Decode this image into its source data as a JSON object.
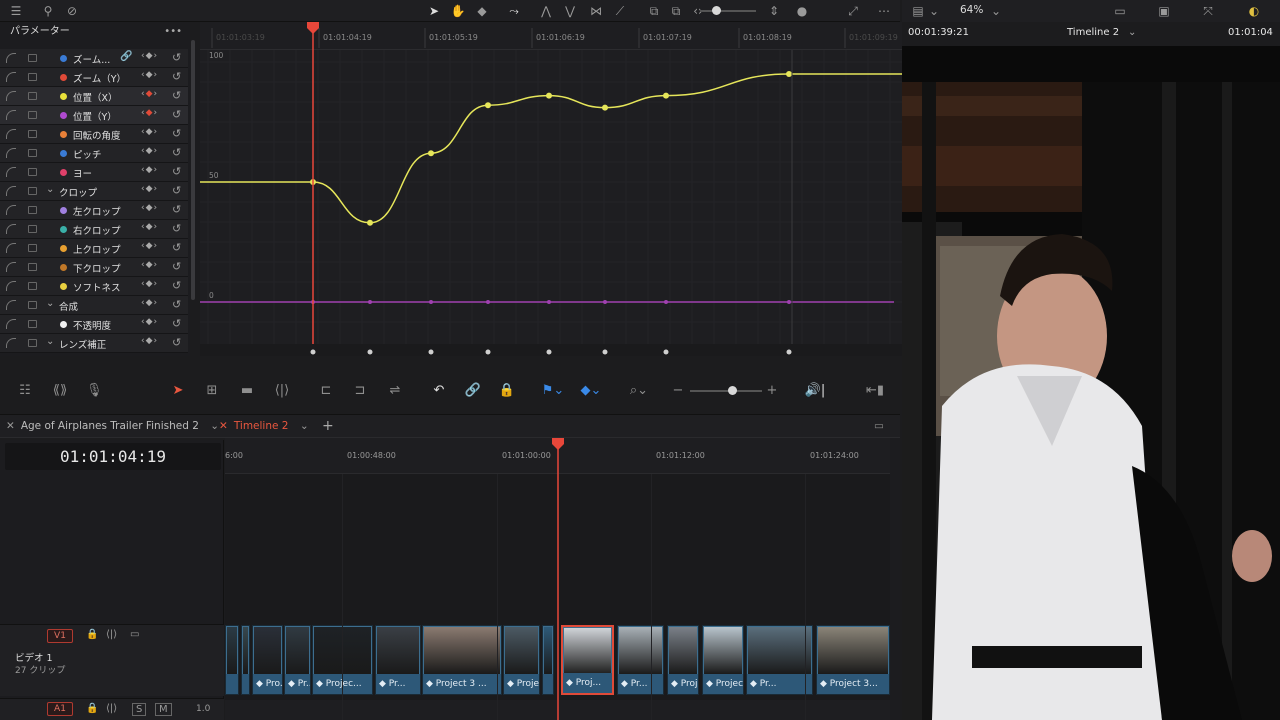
{
  "curve_editor": {
    "param_header": "パラメーター",
    "params": [
      {
        "label": "ズーム...",
        "color": "#3a7bd5",
        "linked": true
      },
      {
        "label": "ズーム（Y）",
        "color": "#e04a38"
      },
      {
        "label": "位置（X）",
        "color": "#e8e03a",
        "selected": true,
        "keyframe_active": true
      },
      {
        "label": "位置（Y）",
        "color": "#b04ad0",
        "selected": true,
        "keyframe_active": true
      },
      {
        "label": "回転の角度",
        "color": "#e88038"
      },
      {
        "label": "ピッチ",
        "color": "#3a7bd5"
      },
      {
        "label": "ヨー",
        "color": "#e0406a"
      },
      {
        "label": "クロップ",
        "group": true
      },
      {
        "label": "左クロップ",
        "color": "#a080e0"
      },
      {
        "label": "右クロップ",
        "color": "#3ab0a8"
      },
      {
        "label": "上クロップ",
        "color": "#e8a030"
      },
      {
        "label": "下クロップ",
        "color": "#c07828"
      },
      {
        "label": "ソフトネス",
        "color": "#e8d040"
      },
      {
        "label": "合成",
        "group": true
      },
      {
        "label": "不透明度",
        "color": "#f0f0f0"
      },
      {
        "label": "レンズ補正",
        "group": true
      }
    ],
    "ruler_labels": [
      "01:01:03:19",
      "01:01:04:19",
      "01:01:05:19",
      "01:01:06:19",
      "01:01:07:19",
      "01:01:08:19",
      "01:01:09:19"
    ],
    "y_labels": [
      "100",
      "50",
      "0"
    ],
    "curve_x": {
      "color": "#e6e65a",
      "keyframes": [
        50,
        33,
        62,
        82,
        86,
        81,
        86,
        95,
        95
      ]
    },
    "curve_y": {
      "color": "#a040b0",
      "keyframes": [
        0,
        0,
        0,
        0,
        0,
        0,
        0,
        0
      ]
    }
  },
  "toolbar": {
    "zoom_icon": "slider"
  },
  "middle_toolbar": {
    "icons": [
      "trim-edit-icon",
      "dynamic-trim-icon",
      "mic-icon",
      "select-arrow-icon",
      "blade-icon",
      "insert-icon",
      "overwrite-icon",
      "replace-icon",
      "snap-icon",
      "link-icon",
      "lock-icon",
      "flag-icon",
      "marker-icon",
      "zoom-icon",
      "volume-icon"
    ]
  },
  "tabs": [
    {
      "label": "Age of Airplanes Trailer Finished 2",
      "active": false
    },
    {
      "label": "Timeline 2",
      "active": true
    }
  ],
  "timeline": {
    "timecode": "01:01:04:19",
    "ruler_labels": [
      "6:00",
      "01:00:48:00",
      "01:01:00:00",
      "01:01:12:00",
      "01:01:24:00"
    ],
    "video_track": {
      "badge": "V1",
      "name": "ビデオ 1",
      "clip_count": "27 クリップ"
    },
    "audio_track": {
      "badge": "A1",
      "solo": "S",
      "mute": "M",
      "level": "1.0"
    },
    "clips": [
      "",
      "Pro...",
      "Pr...",
      "Projec...",
      "Pr...",
      "Project 3 ...",
      "Proje...",
      "",
      "Proj...",
      "Pr...",
      "Proj...",
      "Projec...",
      "Pr...",
      "Project 3..."
    ]
  },
  "viewer": {
    "zoom": "64%",
    "timecode_left": "00:01:39:21",
    "timeline_name": "Timeline 2",
    "timecode_right": "01:01:04"
  }
}
